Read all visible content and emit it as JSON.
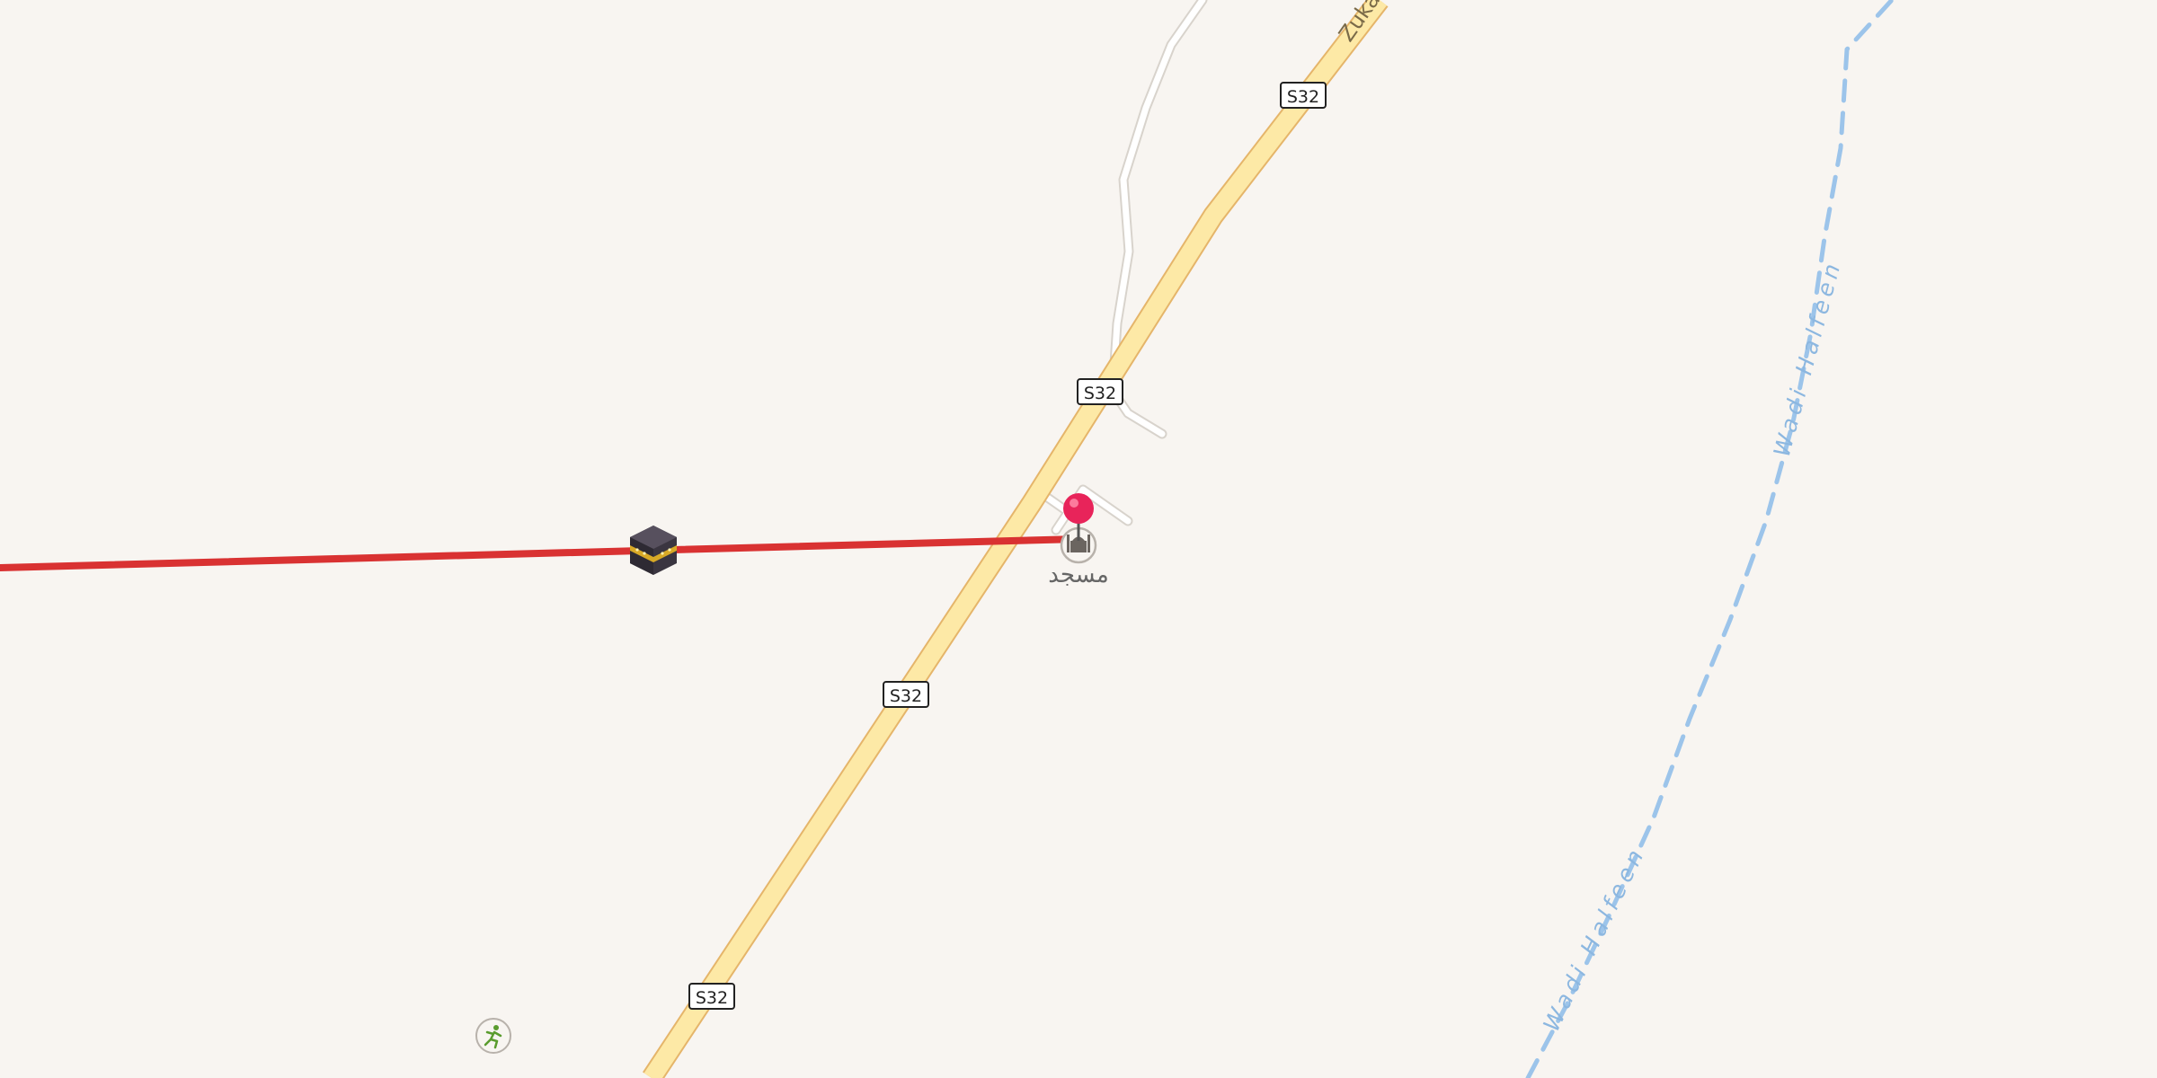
{
  "map": {
    "road": {
      "ref": "S32",
      "name_partial": "Zuka"
    },
    "waterway": {
      "name": "Wadi Halfeen"
    },
    "poi": {
      "mosque_label": "مسجد",
      "mosque_icon": "mosque-icon",
      "sport_icon": "running-person-icon",
      "qibla_icon": "kaaba-icon",
      "pin_icon": "map-pin-icon"
    },
    "qibla_line": {
      "color": "#d93232"
    },
    "colors": {
      "background": "#f8f5f1",
      "primary_road_fill": "#fde9a6",
      "primary_road_casing": "#e5b56a",
      "minor_road": "#ffffff",
      "waterway": "#9cc4ea",
      "pin": "#e8245a"
    }
  }
}
